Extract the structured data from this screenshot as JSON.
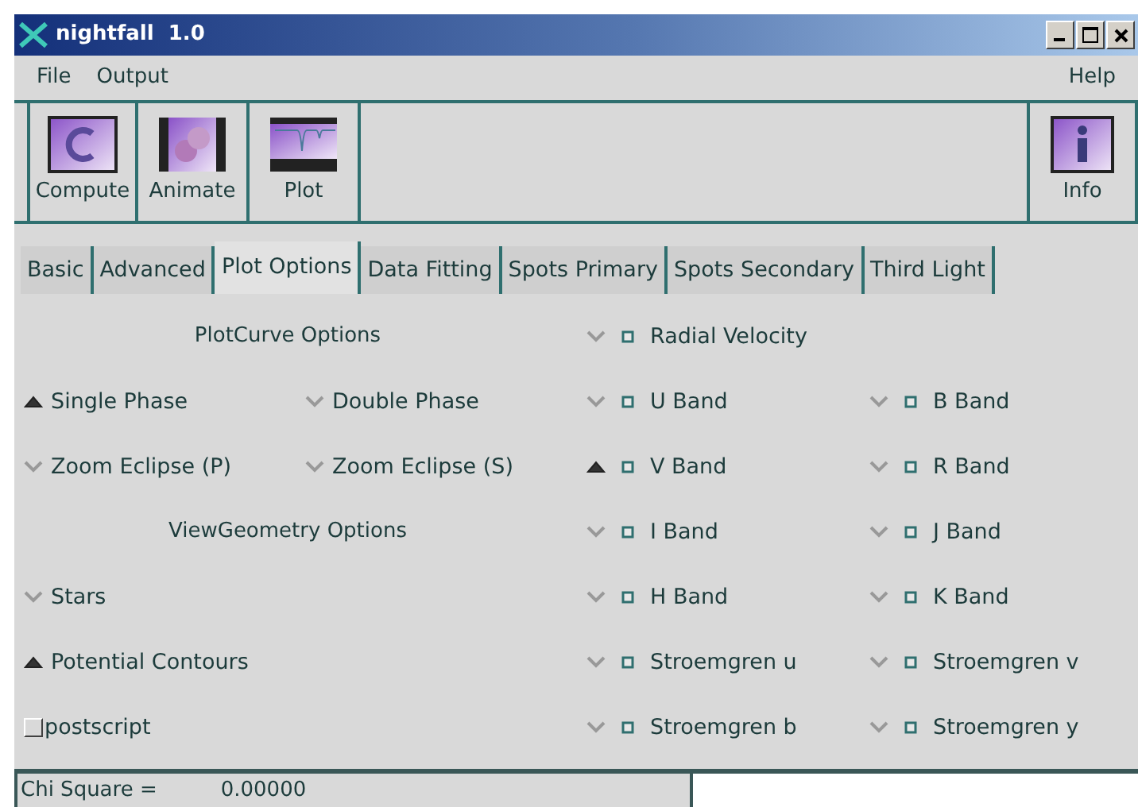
{
  "window": {
    "title": "nightfall  1.0"
  },
  "menu": {
    "left": [
      "File",
      "Output"
    ],
    "right": [
      "Help"
    ]
  },
  "toolbar": {
    "left": [
      {
        "label": "Compute",
        "kind": "compute"
      },
      {
        "label": "Animate",
        "kind": "animate"
      },
      {
        "label": "Plot",
        "kind": "plot"
      }
    ],
    "right": [
      {
        "label": "Info",
        "kind": "info"
      }
    ]
  },
  "tabs": [
    {
      "label": "Basic",
      "selected": false
    },
    {
      "label": "Advanced",
      "selected": false
    },
    {
      "label": "Plot Options",
      "selected": true
    },
    {
      "label": "Data Fitting",
      "selected": false
    },
    {
      "label": "Spots Primary",
      "selected": false
    },
    {
      "label": "Spots Secondary",
      "selected": false
    },
    {
      "label": "Third Light",
      "selected": false
    }
  ],
  "left_rows": [
    [
      {
        "kind": "heading",
        "label": "PlotCurve Options"
      }
    ],
    [
      {
        "kind": "radio",
        "label": "Single Phase",
        "selected": true
      },
      {
        "kind": "radio",
        "label": "Double Phase",
        "selected": false
      }
    ],
    [
      {
        "kind": "radio",
        "label": "Zoom Eclipse (P)",
        "selected": false
      },
      {
        "kind": "radio",
        "label": "Zoom Eclipse (S)",
        "selected": false
      }
    ],
    [
      {
        "kind": "heading",
        "label": "ViewGeometry Options"
      }
    ],
    [
      {
        "kind": "radio",
        "label": "Stars",
        "selected": false
      }
    ],
    [
      {
        "kind": "radio",
        "label": "Potential Contours",
        "selected": true
      }
    ],
    [
      {
        "kind": "checkbox",
        "label": "postscript",
        "checked": false
      }
    ]
  ],
  "band_rows": [
    [
      {
        "label": "Radial Velocity",
        "selected": false
      }
    ],
    [
      {
        "label": "U Band",
        "selected": false
      },
      {
        "label": "B Band",
        "selected": false
      }
    ],
    [
      {
        "label": "V Band",
        "selected": true
      },
      {
        "label": "R Band",
        "selected": false
      }
    ],
    [
      {
        "label": "I Band",
        "selected": false
      },
      {
        "label": "J Band",
        "selected": false
      }
    ],
    [
      {
        "label": "H Band",
        "selected": false
      },
      {
        "label": "K Band",
        "selected": false
      }
    ],
    [
      {
        "label": "Stroemgren u",
        "selected": false
      },
      {
        "label": "Stroemgren v",
        "selected": false
      }
    ],
    [
      {
        "label": "Stroemgren b",
        "selected": false
      },
      {
        "label": "Stroemgren y",
        "selected": false
      }
    ]
  ],
  "status_bar": {
    "label": "Chi Square =",
    "value": "0.00000"
  }
}
